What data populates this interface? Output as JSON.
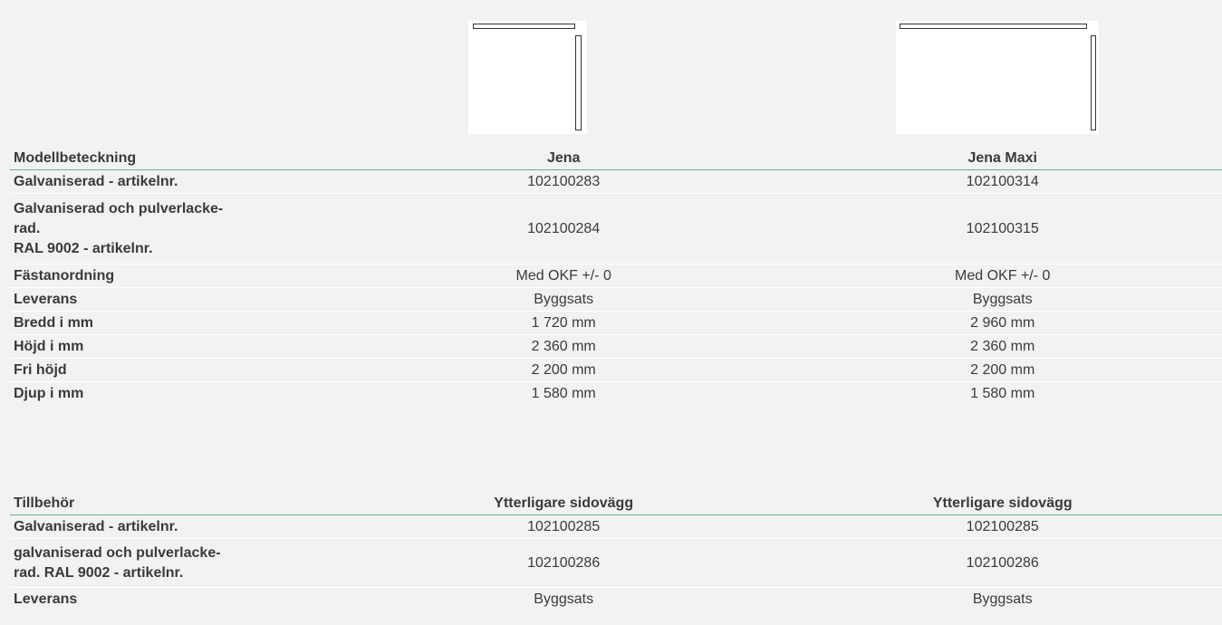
{
  "spec_table": {
    "header": {
      "label": "Modellbeteckning",
      "col1": "Jena",
      "col2": "Jena Maxi"
    },
    "rows": [
      {
        "label": "Galvaniserad - artikelnr.",
        "col1": "102100283",
        "col2": "102100314"
      },
      {
        "label": "Galvaniserad och pulverlacke-\nrad.\nRAL 9002 - artikelnr.",
        "col1": "102100284",
        "col2": "102100315"
      },
      {
        "label": "Fästanordning",
        "col1": "Med OKF +/- 0",
        "col2": "Med OKF +/- 0"
      },
      {
        "label": "Leverans",
        "col1": "Byggsats",
        "col2": "Byggsats"
      },
      {
        "label": "Bredd i mm",
        "col1": "1 720 mm",
        "col2": "2 960 mm"
      },
      {
        "label": "Höjd i mm",
        "col1": "2 360 mm",
        "col2": "2 360 mm"
      },
      {
        "label": "Fri höjd",
        "col1": "2 200 mm",
        "col2": "2 200 mm"
      },
      {
        "label": "Djup i mm",
        "col1": "1 580 mm",
        "col2": "1 580 mm"
      }
    ]
  },
  "accessory_table": {
    "header": {
      "label": "Tillbehör",
      "col1": "Ytterligare sidovägg",
      "col2": "Ytterligare sidovägg"
    },
    "rows": [
      {
        "label": "Galvaniserad - artikelnr.",
        "col1": "102100285",
        "col2": "102100285"
      },
      {
        "label": "galvaniserad och pulverlacke-\nrad. RAL 9002 - artikelnr.",
        "col1": "102100286",
        "col2": "102100286"
      },
      {
        "label": "Leverans",
        "col1": "Byggsats",
        "col2": "Byggsats"
      }
    ]
  },
  "colors": {
    "background": "#f2f2f2",
    "header_rule": "#6bb28a",
    "text": "#3a3a3a"
  }
}
